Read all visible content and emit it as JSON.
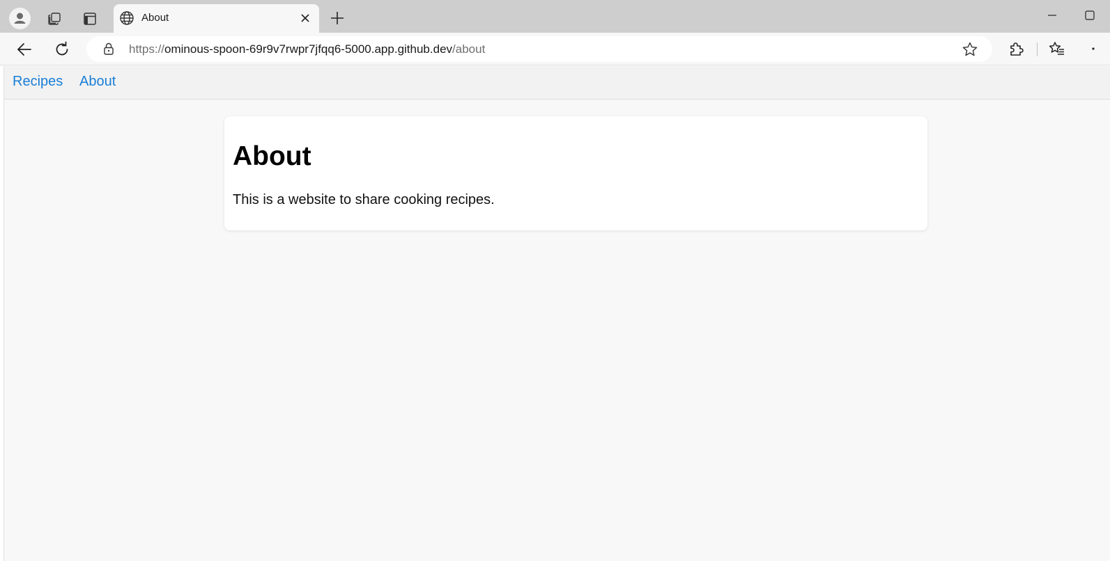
{
  "browser": {
    "tab": {
      "title": "About",
      "favicon": "globe-icon"
    },
    "address_bar": {
      "scheme": "https://",
      "host": "ominous-spoon-69r9v7rwpr7jfqq6-5000.app.github.dev",
      "path": "/about"
    },
    "icons": {
      "profile": "profile-icon",
      "workspaces": "workspaces-icon",
      "vertical_tabs": "vertical-tabs-icon",
      "tab_close": "close-icon",
      "new_tab": "plus-icon",
      "back": "back-arrow-icon",
      "reload": "reload-icon",
      "lock": "lock-icon",
      "favorite": "star-icon",
      "extensions": "puzzle-icon",
      "favorites": "favorites-icon",
      "more": "more-icon",
      "minimize": "minimize-icon",
      "maximize": "maximize-icon"
    }
  },
  "site": {
    "nav": [
      {
        "label": "Recipes"
      },
      {
        "label": "About"
      }
    ],
    "content": {
      "heading": "About",
      "text": "This is a website to share cooking recipes."
    }
  },
  "colors": {
    "link": "#1a7ed6",
    "page_background": "#f8f8f8",
    "card_background": "#ffffff",
    "tabstrip": "#cecece"
  }
}
